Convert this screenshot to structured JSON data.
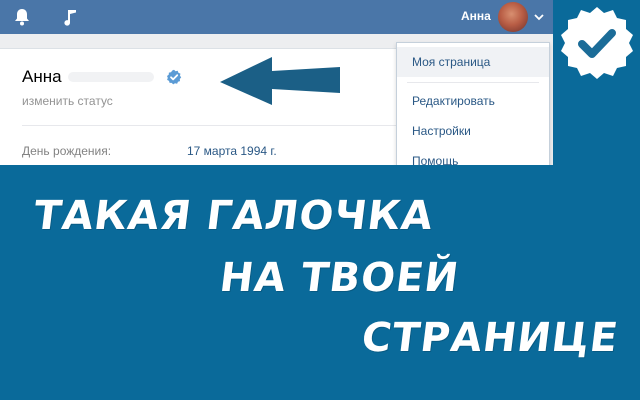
{
  "topbar": {
    "user_name": "Анна",
    "icons": [
      "bell-icon",
      "music-icon",
      "chevron-down-icon"
    ]
  },
  "profile": {
    "name": "Анна",
    "status_link": "изменить статус",
    "fields": [
      {
        "label": "День рождения:",
        "value": "17 марта 1994 г."
      }
    ]
  },
  "menu": {
    "items": [
      {
        "label": "Моя страница",
        "active": true
      },
      {
        "label": "Редактировать",
        "active": false
      },
      {
        "label": "Настройки",
        "active": false
      },
      {
        "label": "Помощь",
        "active": false
      }
    ]
  },
  "headline": {
    "line1": "ТАКАЯ ГАЛОЧКА",
    "line2": "НА ТВОЕЙ",
    "line3": "СТРАНИЦЕ"
  },
  "colors": {
    "topbar": "#4a76a8",
    "background": "#0a6a9a",
    "link": "#2a5885",
    "verify": "#5b9bd5"
  }
}
